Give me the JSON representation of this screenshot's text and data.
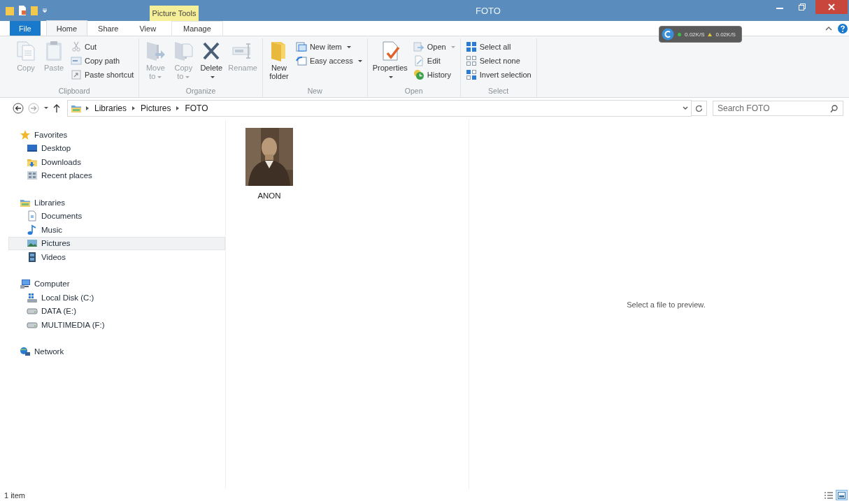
{
  "window": {
    "title": "FOTO",
    "contextual_tab": "Picture Tools"
  },
  "tabs": [
    {
      "label": "File",
      "kind": "file",
      "selected": false
    },
    {
      "label": "Home",
      "kind": "normal",
      "selected": true
    },
    {
      "label": "Share",
      "kind": "normal",
      "selected": false
    },
    {
      "label": "View",
      "kind": "normal",
      "selected": false
    },
    {
      "label": "Manage",
      "kind": "contextual",
      "selected": false
    }
  ],
  "speed_meter": {
    "download": "0.02K/S",
    "upload": "0.02K/S"
  },
  "ribbon": {
    "groups": [
      {
        "name": "Clipboard",
        "large": [
          {
            "label": "Copy",
            "kind": "copy",
            "disabled": true,
            "dropdown": false
          },
          {
            "label": "Paste",
            "kind": "paste",
            "disabled": true,
            "dropdown": false
          }
        ],
        "small": [
          {
            "label": "Cut",
            "kind": "cut",
            "disabled": true,
            "dropdown": false
          },
          {
            "label": "Copy path",
            "kind": "copy-path",
            "disabled": true,
            "dropdown": false
          },
          {
            "label": "Paste shortcut",
            "kind": "paste-shortcut",
            "disabled": true,
            "dropdown": false
          }
        ]
      },
      {
        "name": "Organize",
        "large": [
          {
            "label": "Move to",
            "kind": "move",
            "disabled": true,
            "dropdown": true
          },
          {
            "label": "Copy to",
            "kind": "copy-to",
            "disabled": true,
            "dropdown": true
          },
          {
            "label": "Delete",
            "kind": "delete",
            "disabled": false,
            "dropdown": true
          },
          {
            "label": "Rename",
            "kind": "rename",
            "disabled": true,
            "dropdown": false
          }
        ]
      },
      {
        "name": "New",
        "large": [
          {
            "label": "New folder",
            "kind": "new-folder",
            "disabled": false,
            "dropdown": false
          }
        ],
        "small": [
          {
            "label": "New item",
            "kind": "new-item",
            "disabled": false,
            "dropdown": true
          },
          {
            "label": "Easy access",
            "kind": "easy-access",
            "disabled": false,
            "dropdown": true
          }
        ]
      },
      {
        "name": "Open",
        "large": [
          {
            "label": "Properties",
            "kind": "properties",
            "disabled": false,
            "dropdown": true
          }
        ],
        "small": [
          {
            "label": "Open",
            "kind": "open",
            "disabled": true,
            "dropdown": true
          },
          {
            "label": "Edit",
            "kind": "edit",
            "disabled": true,
            "dropdown": false
          },
          {
            "label": "History",
            "kind": "history",
            "disabled": false,
            "dropdown": false
          }
        ]
      },
      {
        "name": "Select",
        "small": [
          {
            "label": "Select all",
            "kind": "select-all",
            "disabled": false,
            "dropdown": false
          },
          {
            "label": "Select none",
            "kind": "select-none",
            "disabled": false,
            "dropdown": false
          },
          {
            "label": "Invert selection",
            "kind": "invert",
            "disabled": false,
            "dropdown": false
          }
        ]
      }
    ]
  },
  "nav_buttons": [
    {
      "kind": "back",
      "disabled": false
    },
    {
      "kind": "forward",
      "disabled": true
    }
  ],
  "address": {
    "path": [
      "Libraries",
      "Pictures",
      "FOTO"
    ]
  },
  "search": {
    "placeholder": "Search FOTO"
  },
  "sidebar": {
    "groups": [
      {
        "label": "Favorites",
        "kind": "favorites",
        "selected": false,
        "children": [
          {
            "label": "Desktop",
            "kind": "desktop",
            "selected": false
          },
          {
            "label": "Downloads",
            "kind": "downloads",
            "selected": false
          },
          {
            "label": "Recent places",
            "kind": "recent",
            "selected": false
          }
        ]
      },
      {
        "label": "Libraries",
        "kind": "libraries",
        "selected": false,
        "children": [
          {
            "label": "Documents",
            "kind": "documents",
            "selected": false
          },
          {
            "label": "Music",
            "kind": "music",
            "selected": false
          },
          {
            "label": "Pictures",
            "kind": "pictures",
            "selected": true
          },
          {
            "label": "Videos",
            "kind": "videos",
            "selected": false
          }
        ]
      },
      {
        "label": "Computer",
        "kind": "computer",
        "selected": false,
        "children": [
          {
            "label": "Local Disk (C:)",
            "kind": "local-disk",
            "selected": false
          },
          {
            "label": "DATA (E:)",
            "kind": "drive",
            "selected": false
          },
          {
            "label": "MULTIMEDIA (F:)",
            "kind": "drive",
            "selected": false
          }
        ]
      },
      {
        "label": "Network",
        "kind": "network",
        "selected": false
      }
    ]
  },
  "files": [
    {
      "name": "ANON",
      "kind": "picture",
      "selected": false
    }
  ],
  "preview": {
    "message": "Select a file to preview."
  },
  "status_bar": {
    "text": "1 item"
  },
  "view_buttons": [
    {
      "kind": "details",
      "selected": false
    },
    {
      "kind": "icons",
      "selected": true
    }
  ]
}
